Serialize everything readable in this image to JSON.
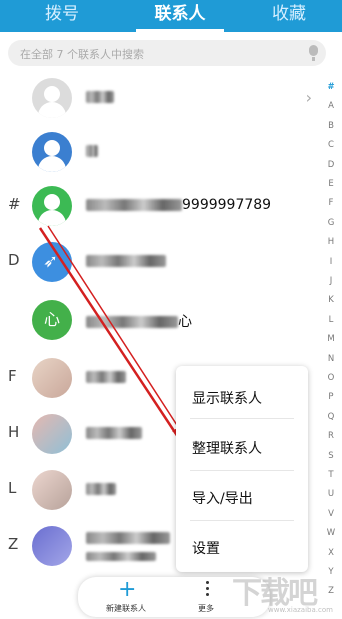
{
  "tabs": [
    {
      "label": "拨号"
    },
    {
      "label": "联系人"
    },
    {
      "label": "收藏"
    }
  ],
  "search": {
    "placeholder": "在全部 7 个联系人中搜索"
  },
  "contacts": [
    {
      "section": "",
      "avatar_text": "",
      "name_visible": ""
    },
    {
      "section": "",
      "avatar_text": "",
      "name_visible": ""
    },
    {
      "section": "#",
      "avatar_text": "",
      "name_visible": "9999997789"
    },
    {
      "section": "D",
      "avatar_text": "",
      "name_visible": ""
    },
    {
      "section": "",
      "avatar_text": "心",
      "name_visible": "心"
    },
    {
      "section": "F",
      "avatar_text": "",
      "name_visible": ""
    },
    {
      "section": "H",
      "avatar_text": "",
      "name_visible": ""
    },
    {
      "section": "L",
      "avatar_text": "",
      "name_visible": ""
    },
    {
      "section": "Z",
      "avatar_text": "",
      "name_visible": ""
    }
  ],
  "index_letters": [
    "#",
    "A",
    "B",
    "C",
    "D",
    "E",
    "F",
    "G",
    "H",
    "I",
    "J",
    "K",
    "L",
    "M",
    "N",
    "O",
    "P",
    "Q",
    "R",
    "S",
    "T",
    "U",
    "V",
    "W",
    "X",
    "Y",
    "Z"
  ],
  "menu": {
    "items": [
      "显示联系人",
      "整理联系人",
      "导入/导出",
      "设置"
    ]
  },
  "bottom": {
    "new_label": "新建联系人",
    "more_label": "更多"
  },
  "watermark": {
    "text": "下载吧",
    "sub": "www.xiazaiba.com"
  },
  "colors": {
    "accent": "#1f9bd6",
    "arrow": "#d42020"
  }
}
